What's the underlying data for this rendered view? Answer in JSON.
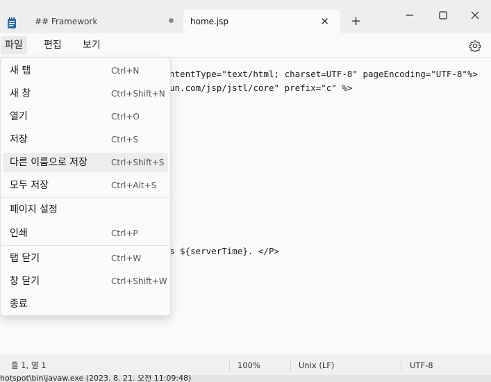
{
  "titlebar": {
    "tabs": [
      {
        "label": "## Framework",
        "unsaved": true
      },
      {
        "label": "home.jsp",
        "active": true
      }
    ]
  },
  "menubar": {
    "items": [
      "파일",
      "편집",
      "보기"
    ]
  },
  "file_menu": {
    "items": [
      {
        "label": "새 탭",
        "shortcut": "Ctrl+N"
      },
      {
        "label": "새 창",
        "shortcut": "Ctrl+Shift+N"
      },
      {
        "label": "열기",
        "shortcut": "Ctrl+O"
      },
      {
        "label": "저장",
        "shortcut": "Ctrl+S"
      },
      {
        "label": "다른 이름으로 저장",
        "shortcut": "Ctrl+Shift+S"
      },
      {
        "label": "모두 저장",
        "shortcut": "Ctrl+Alt+S"
      },
      {
        "label": "페이지 설정",
        "shortcut": ""
      },
      {
        "label": "인쇄",
        "shortcut": "Ctrl+P"
      },
      {
        "label": "탭 닫기",
        "shortcut": "Ctrl+W"
      },
      {
        "label": "창 닫기",
        "shortcut": "Ctrl+Shift+W"
      },
      {
        "label": "종료",
        "shortcut": ""
      }
    ]
  },
  "editor": {
    "line1": "ntentType=\"text/html; charset=UTF-8\" pageEncoding=\"UTF-8\"%>",
    "line2": "un.com/jsp/jstl/core\" prefix=\"c\" %>",
    "line3": "s ${serverTime}. </P>"
  },
  "status": {
    "position": "줄 1, 열 1",
    "zoom": "100%",
    "line_ending": "Unix (LF)",
    "encoding": "UTF-8"
  },
  "taskbar": {
    "text": "hotspot\\bin\\javaw.exe (2023. 8. 21. 오전 11:09:48)"
  },
  "colors": {
    "highlight": "#f5f200",
    "menu_hover": "#ededed"
  }
}
